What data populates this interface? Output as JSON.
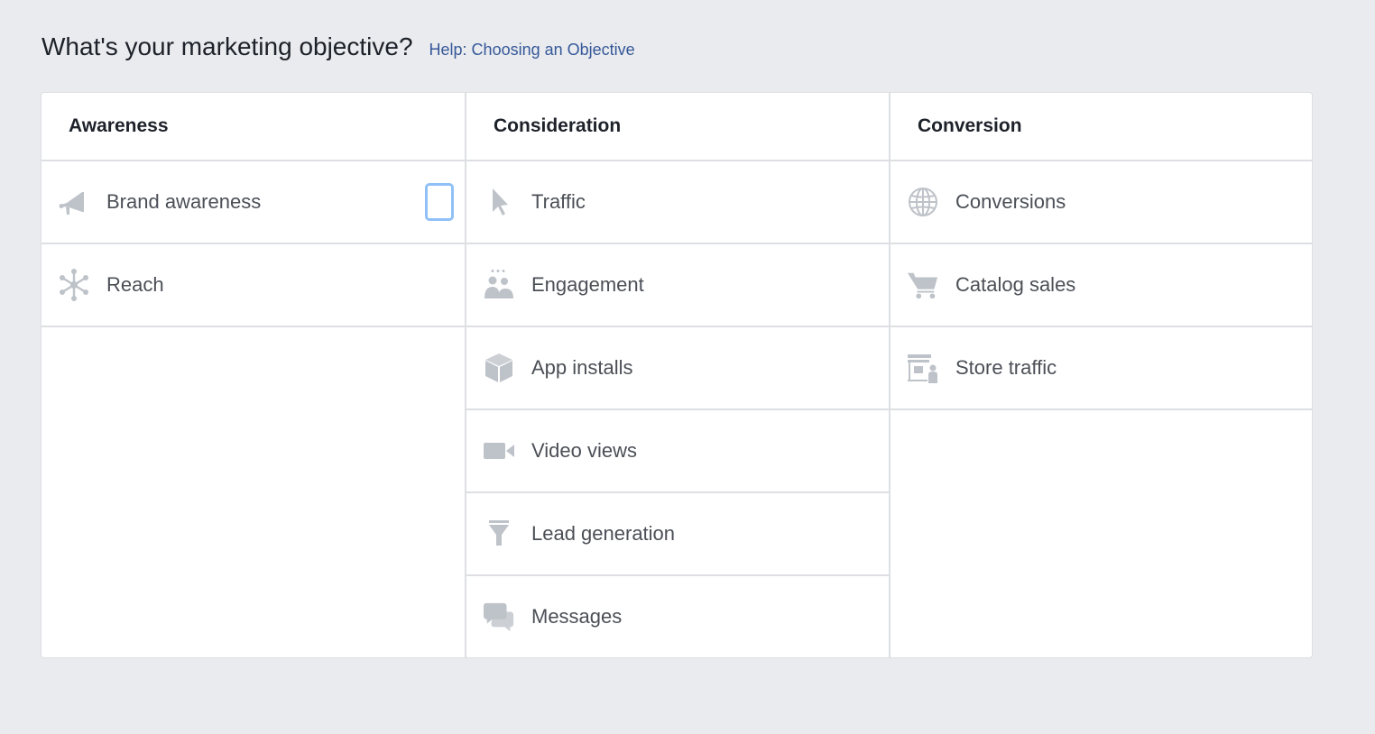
{
  "header": {
    "title": "What's your marketing objective?",
    "help_link": "Help: Choosing an Objective"
  },
  "columns": [
    {
      "heading": "Awareness",
      "items": [
        {
          "label": "Brand awareness",
          "icon": "megaphone-icon",
          "focused": true
        },
        {
          "label": "Reach",
          "icon": "network-icon"
        }
      ]
    },
    {
      "heading": "Consideration",
      "items": [
        {
          "label": "Traffic",
          "icon": "cursor-icon"
        },
        {
          "label": "Engagement",
          "icon": "people-icon"
        },
        {
          "label": "App installs",
          "icon": "box-icon"
        },
        {
          "label": "Video views",
          "icon": "video-camera-icon"
        },
        {
          "label": "Lead generation",
          "icon": "funnel-icon"
        },
        {
          "label": "Messages",
          "icon": "chat-bubbles-icon"
        }
      ]
    },
    {
      "heading": "Conversion",
      "items": [
        {
          "label": "Conversions",
          "icon": "globe-icon"
        },
        {
          "label": "Catalog sales",
          "icon": "shopping-cart-icon"
        },
        {
          "label": "Store traffic",
          "icon": "storefront-icon"
        }
      ]
    }
  ],
  "colors": {
    "icon": "#bec3c9",
    "link": "#365899",
    "focus": "#8fc1f8",
    "background": "#e9ebee"
  }
}
